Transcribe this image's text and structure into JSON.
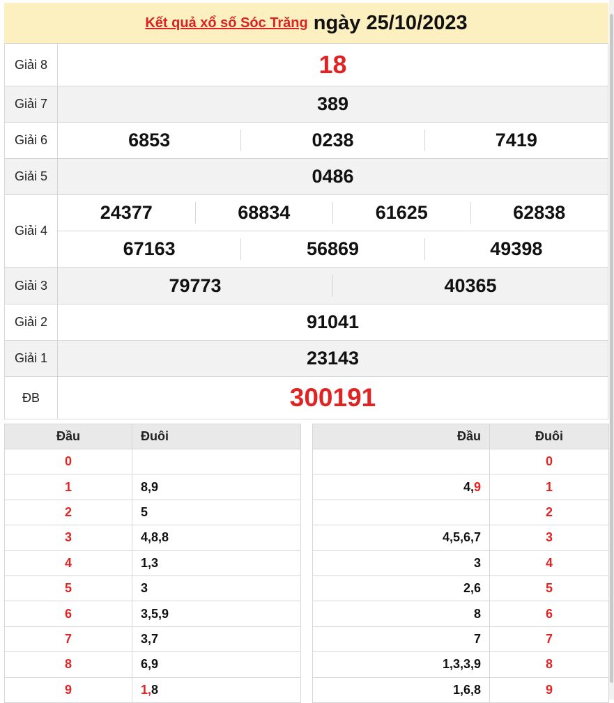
{
  "header": {
    "title_link": "Kết quả xổ số Sóc Trăng",
    "title_date": "ngày 25/10/2023"
  },
  "prizes": [
    {
      "label": "Giải 8",
      "numbers": [
        "18"
      ]
    },
    {
      "label": "Giải 7",
      "numbers": [
        "389"
      ]
    },
    {
      "label": "Giải 6",
      "numbers": [
        "6853",
        "0238",
        "7419"
      ]
    },
    {
      "label": "Giải 5",
      "numbers": [
        "0486"
      ]
    },
    {
      "label": "Giải 4",
      "numbers": [
        "24377",
        "68834",
        "61625",
        "62838",
        "67163",
        "56869",
        "49398"
      ]
    },
    {
      "label": "Giải 3",
      "numbers": [
        "79773",
        "40365"
      ]
    },
    {
      "label": "Giải 2",
      "numbers": [
        "91041"
      ]
    },
    {
      "label": "Giải 1",
      "numbers": [
        "23143"
      ]
    },
    {
      "label": "ĐB",
      "numbers": [
        "300191"
      ]
    }
  ],
  "loto_head": {
    "col_digit": "Đầu",
    "col_values": "Đuôi",
    "rows": [
      {
        "digit": "0",
        "values": ""
      },
      {
        "digit": "1",
        "values": "8,9"
      },
      {
        "digit": "2",
        "values": "5"
      },
      {
        "digit": "3",
        "values": "4,8,8"
      },
      {
        "digit": "4",
        "values": "1,3"
      },
      {
        "digit": "5",
        "values": "3"
      },
      {
        "digit": "6",
        "values": "3,5,9"
      },
      {
        "digit": "7",
        "values": "3,7"
      },
      {
        "digit": "8",
        "values": "6,9"
      },
      {
        "digit": "9",
        "values": "1,8",
        "highlight": "1"
      }
    ]
  },
  "loto_tail": {
    "col_values": "Đầu",
    "col_digit": "Đuôi",
    "rows": [
      {
        "digit": "0",
        "values": ""
      },
      {
        "digit": "1",
        "values": "4,9",
        "highlight": "9"
      },
      {
        "digit": "2",
        "values": ""
      },
      {
        "digit": "3",
        "values": "4,5,6,7"
      },
      {
        "digit": "4",
        "values": "3"
      },
      {
        "digit": "5",
        "values": "2,6"
      },
      {
        "digit": "6",
        "values": "8"
      },
      {
        "digit": "7",
        "values": "7"
      },
      {
        "digit": "8",
        "values": "1,3,3,9"
      },
      {
        "digit": "9",
        "values": "1,6,8"
      }
    ]
  },
  "colors": {
    "accent_red": "#e02424",
    "title_bg": "#fdf0c0",
    "row_alt": "#f2f2f2"
  }
}
